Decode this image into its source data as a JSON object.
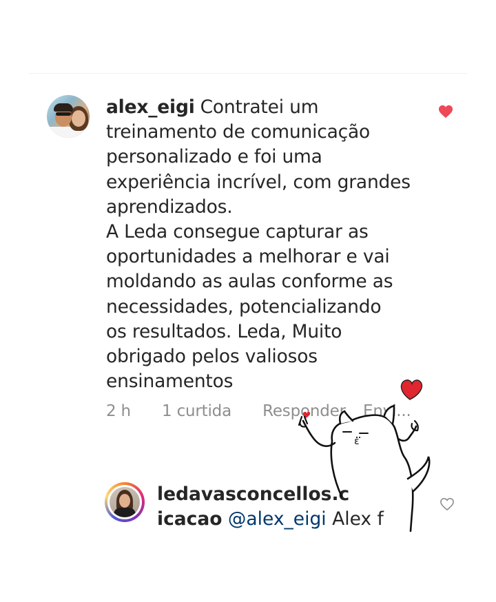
{
  "comment1": {
    "username": "alex_eigi",
    "text": "Contratei um\ntreinamento de comunicação\npersonalizado e foi uma\nexperiência incrível, com grandes\naprendizados.\nA Leda consegue capturar as\noportunidades a melhorar e vai\nmoldando as aulas conforme as\nnecessidades, potencializando\nos resultados. Leda, Muito\nobrigado pelos valiosos\nensinamentos",
    "time": "2 h",
    "likes": "1 curtida",
    "reply_label": "Responder",
    "send_label": "Envi...",
    "liked": true,
    "avatar_icon": "profile-photo"
  },
  "comment2": {
    "username": "ledavasconcellos.c",
    "username_cont": "icacao",
    "mention": "@alex_eigi",
    "text": "Alex foi",
    "liked": false,
    "avatar_icon": "profile-photo-story-ring"
  },
  "colors": {
    "like_red": "#ed4956",
    "meta_gray": "#8e8e8e",
    "mention_blue": "#00376b",
    "sticker_heart": "#e0262e"
  },
  "sticker": {
    "icon": "cat-finger-heart-sticker"
  }
}
